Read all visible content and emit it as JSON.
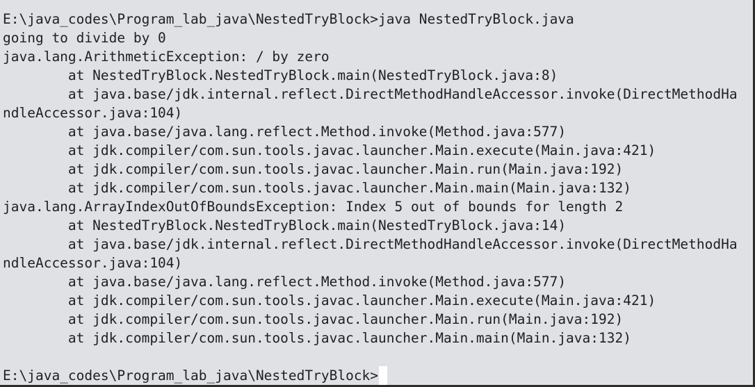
{
  "terminal": {
    "lines": [
      "E:\\java_codes\\Program_lab_java\\NestedTryBlock>java NestedTryBlock.java",
      "going to divide by 0",
      "java.lang.ArithmeticException: / by zero",
      "        at NestedTryBlock.NestedTryBlock.main(NestedTryBlock.java:8)",
      "        at java.base/jdk.internal.reflect.DirectMethodHandleAccessor.invoke(DirectMethodHa",
      "ndleAccessor.java:104)",
      "        at java.base/java.lang.reflect.Method.invoke(Method.java:577)",
      "        at jdk.compiler/com.sun.tools.javac.launcher.Main.execute(Main.java:421)",
      "        at jdk.compiler/com.sun.tools.javac.launcher.Main.run(Main.java:192)",
      "        at jdk.compiler/com.sun.tools.javac.launcher.Main.main(Main.java:132)",
      "java.lang.ArrayIndexOutOfBoundsException: Index 5 out of bounds for length 2",
      "        at NestedTryBlock.NestedTryBlock.main(NestedTryBlock.java:14)",
      "        at java.base/jdk.internal.reflect.DirectMethodHandleAccessor.invoke(DirectMethodHa",
      "ndleAccessor.java:104)",
      "        at java.base/java.lang.reflect.Method.invoke(Method.java:577)",
      "        at jdk.compiler/com.sun.tools.javac.launcher.Main.execute(Main.java:421)",
      "        at jdk.compiler/com.sun.tools.javac.launcher.Main.run(Main.java:192)",
      "        at jdk.compiler/com.sun.tools.javac.launcher.Main.main(Main.java:132)",
      ""
    ],
    "prompt": "E:\\java_codes\\Program_lab_java\\NestedTryBlock>"
  }
}
